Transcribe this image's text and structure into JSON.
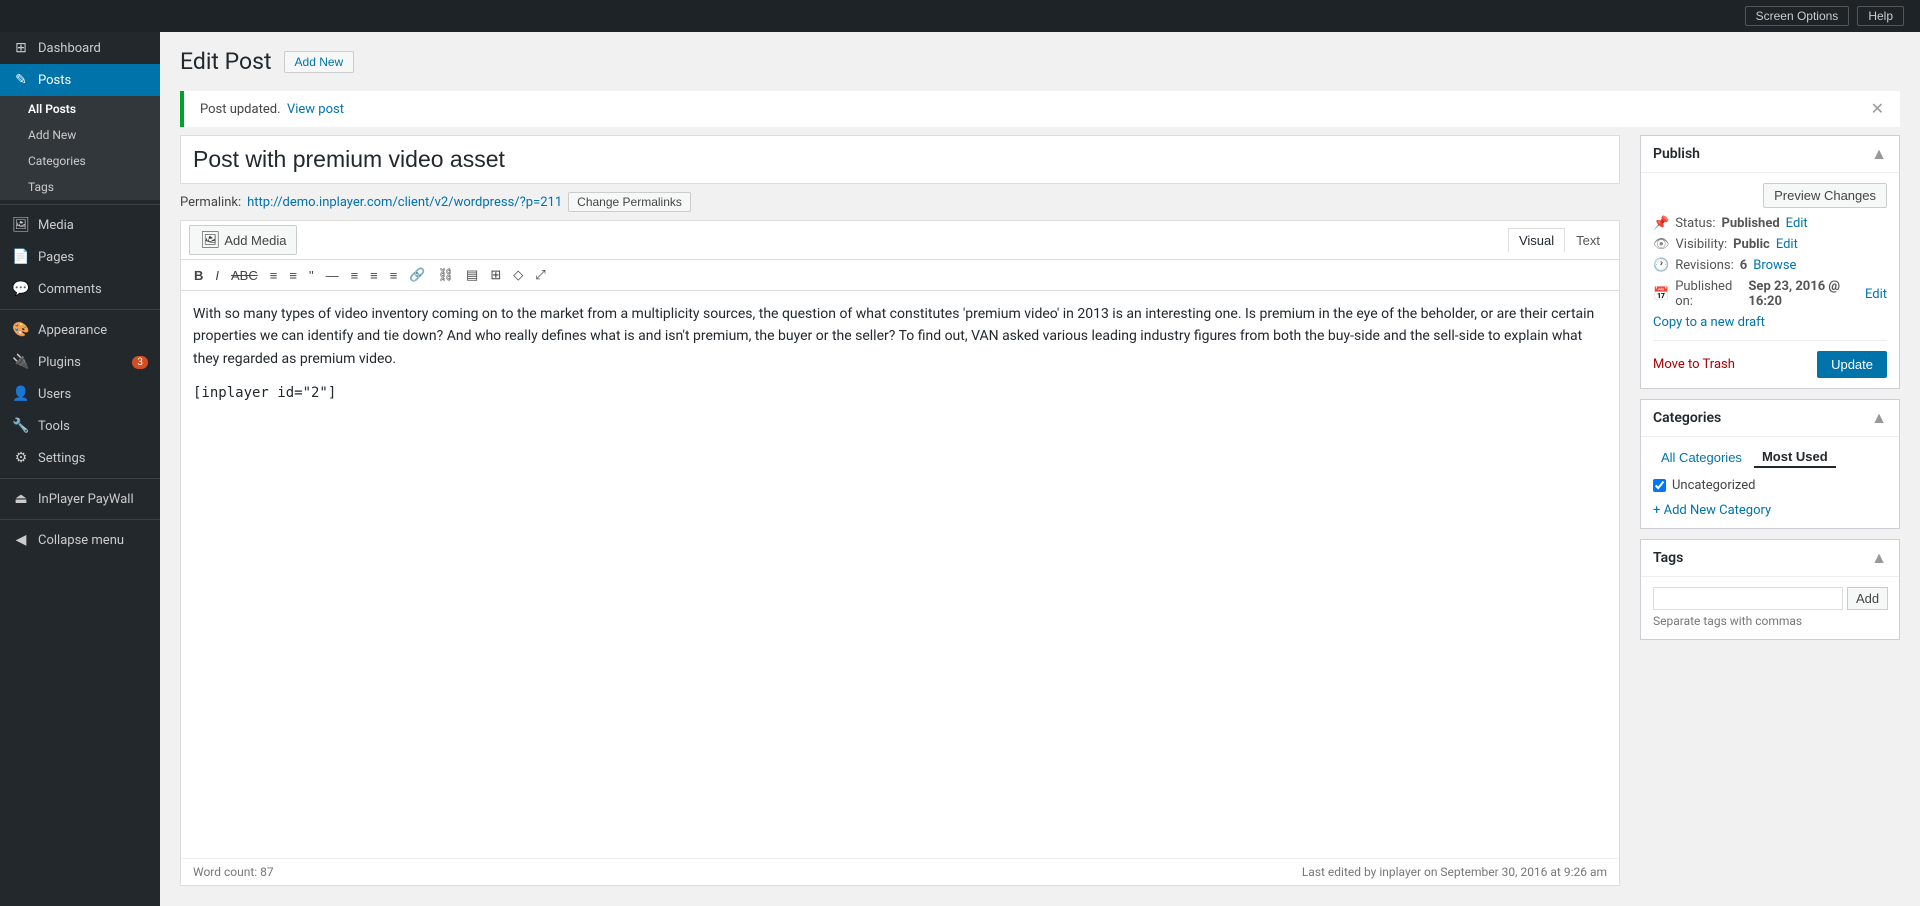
{
  "topbar": {
    "screen_options_label": "Screen Options",
    "help_label": "Help"
  },
  "sidebar": {
    "items": [
      {
        "id": "dashboard",
        "label": "Dashboard",
        "icon": "⊞",
        "active": false
      },
      {
        "id": "posts",
        "label": "Posts",
        "icon": "📝",
        "active": true
      },
      {
        "id": "media",
        "label": "Media",
        "icon": "🖼",
        "active": false
      },
      {
        "id": "pages",
        "label": "Pages",
        "icon": "📄",
        "active": false
      },
      {
        "id": "comments",
        "label": "Comments",
        "icon": "💬",
        "active": false
      },
      {
        "id": "appearance",
        "label": "Appearance",
        "icon": "🎨",
        "active": false
      },
      {
        "id": "plugins",
        "label": "Plugins",
        "icon": "🔌",
        "active": false,
        "badge": "3"
      },
      {
        "id": "users",
        "label": "Users",
        "icon": "👤",
        "active": false
      },
      {
        "id": "tools",
        "label": "Tools",
        "icon": "🔧",
        "active": false
      },
      {
        "id": "settings",
        "label": "Settings",
        "icon": "⚙",
        "active": false
      },
      {
        "id": "inplayer",
        "label": "InPlayer PayWall",
        "icon": "⏏",
        "active": false
      }
    ],
    "submenu": [
      {
        "id": "all-posts",
        "label": "All Posts",
        "active": true
      },
      {
        "id": "add-new",
        "label": "Add New",
        "active": false
      },
      {
        "id": "categories",
        "label": "Categories",
        "active": false
      },
      {
        "id": "tags",
        "label": "Tags",
        "active": false
      }
    ],
    "collapse_label": "Collapse menu"
  },
  "page": {
    "title": "Edit Post",
    "add_new_label": "Add New"
  },
  "notification": {
    "message": "Post updated.",
    "link_label": "View post",
    "link_url": "#"
  },
  "post": {
    "title": "Post with premium video asset",
    "permalink_label": "Permalink:",
    "permalink_url": "http://demo.inplayer.com/client/v2/wordpress/?p=211",
    "permalink_url_display": "http://demo.inplayer.com/client/v2/wordpress/?p=211",
    "change_permalink_label": "Change Permalinks",
    "content": "With so many types of video inventory coming on to the market from a multiplicity sources, the question of what constitutes 'premium video' in 2013 is an interesting one. Is premium in the eye of the beholder, or are their certain properties we can identify and tie down? And who really defines what is and isn't premium, the buyer or the seller? To find out, VAN asked various leading industry figures from both the buy-side and the sell-side to explain what they regarded as premium video.",
    "shortcode": "[inplayer id=\"2\"]",
    "word_count_label": "Word count: 87",
    "last_edited": "Last edited by inplayer on September 30, 2016 at 9:26 am"
  },
  "toolbar": {
    "add_media_label": "Add Media",
    "visual_tab": "Visual",
    "text_tab": "Text",
    "buttons": [
      "B",
      "I",
      "ABC",
      "≡",
      "≡",
      "\"",
      "—",
      "≡",
      "≡",
      "≡",
      "🔗",
      "🔗",
      "≡",
      "⊞",
      "◇",
      "⤢"
    ]
  },
  "publish_box": {
    "title": "Publish",
    "preview_changes_label": "Preview Changes",
    "status_label": "Status:",
    "status_value": "Published",
    "status_edit_label": "Edit",
    "visibility_label": "Visibility:",
    "visibility_value": "Public",
    "visibility_edit_label": "Edit",
    "revisions_label": "Revisions:",
    "revisions_value": "6",
    "revisions_browse_label": "Browse",
    "published_on_label": "Published on:",
    "published_on_value": "Sep 23, 2016 @ 16:20",
    "published_on_edit_label": "Edit",
    "copy_draft_label": "Copy to a new draft",
    "move_trash_label": "Move to Trash",
    "update_label": "Update"
  },
  "categories_box": {
    "title": "Categories",
    "all_tab": "All Categories",
    "most_used_tab": "Most Used",
    "items": [
      {
        "id": "uncategorized",
        "label": "Uncategorized",
        "checked": true
      }
    ],
    "add_new_label": "+ Add New Category"
  },
  "tags_box": {
    "title": "Tags",
    "input_placeholder": "",
    "add_label": "Add",
    "hint": "Separate tags with commas"
  }
}
